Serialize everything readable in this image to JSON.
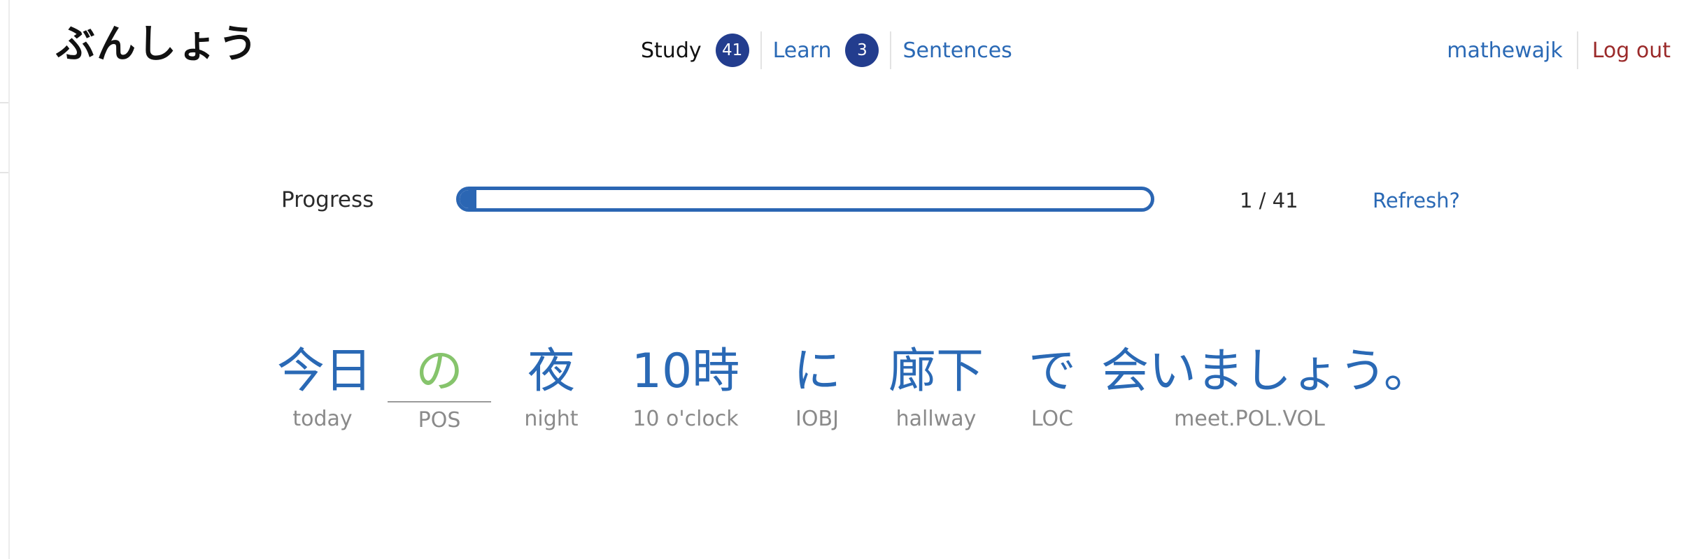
{
  "header": {
    "logo": "ぶんしょう",
    "nav": [
      {
        "label": "Study",
        "badge": "41",
        "active": true
      },
      {
        "label": "Learn",
        "badge": "3",
        "active": false
      },
      {
        "label": "Sentences",
        "badge": "",
        "active": false
      }
    ],
    "account": {
      "username": "mathewajk",
      "logout": "Log out"
    }
  },
  "progress": {
    "label": "Progress",
    "current": 1,
    "total": 41,
    "count_text": "1 / 41",
    "refresh": "Refresh?"
  },
  "sentence": {
    "words": [
      {
        "jp": "今日",
        "gloss": "today"
      },
      {
        "jp": "の",
        "gloss": "POS",
        "selected": true
      },
      {
        "jp": "夜",
        "gloss": "night"
      },
      {
        "jp": "10時",
        "gloss": "10 o'clock"
      },
      {
        "jp": "に",
        "gloss": "IOBJ"
      },
      {
        "jp": "廊下",
        "gloss": "hallway"
      },
      {
        "jp": "で",
        "gloss": "LOC"
      },
      {
        "jp": "会いましょう。",
        "gloss": "meet.POL.VOL"
      }
    ]
  },
  "colors": {
    "link": "#2a69b5",
    "badge": "#233d8e",
    "progress": "#2b66b3",
    "selected_word": "#86c46c",
    "logout": "#9b2a2a"
  }
}
